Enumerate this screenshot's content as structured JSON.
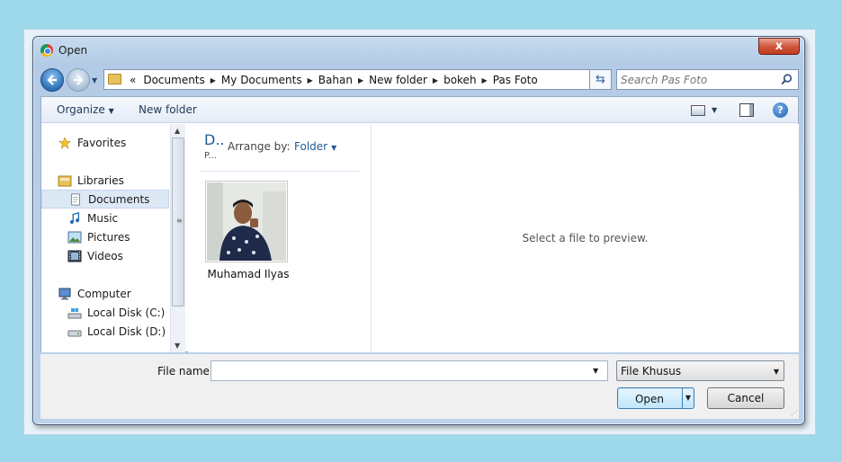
{
  "window": {
    "title": "Open",
    "close_symbol": "x"
  },
  "address_bar": {
    "lead_symbol": "«",
    "crumbs": [
      "Documents",
      "My Documents",
      "Bahan",
      "New folder",
      "bokeh",
      "Pas Foto"
    ]
  },
  "search": {
    "placeholder": "Search Pas Foto"
  },
  "toolbar": {
    "organize": "Organize",
    "new_folder": "New folder",
    "help_symbol": "?"
  },
  "nav_pane": {
    "favorites": "Favorites",
    "libraries": "Libraries",
    "documents": "Documents",
    "music": "Music",
    "pictures": "Pictures",
    "videos": "Videos",
    "computer": "Computer",
    "local_disk_c": "Local Disk (C:)",
    "local_disk_d": "Local Disk (D:)"
  },
  "file_area": {
    "library_title": "D..",
    "library_subtitle": "P...",
    "arrange_label": "Arrange by:",
    "arrange_value": "Folder",
    "files": [
      {
        "name": "Muhamad Ilyas"
      }
    ]
  },
  "preview": {
    "text": "Select a file to preview."
  },
  "bottom": {
    "file_name_label": "File name:",
    "file_name_value": "",
    "filter_value": "File Khusus",
    "open_label": "Open",
    "cancel_label": "Cancel"
  }
}
